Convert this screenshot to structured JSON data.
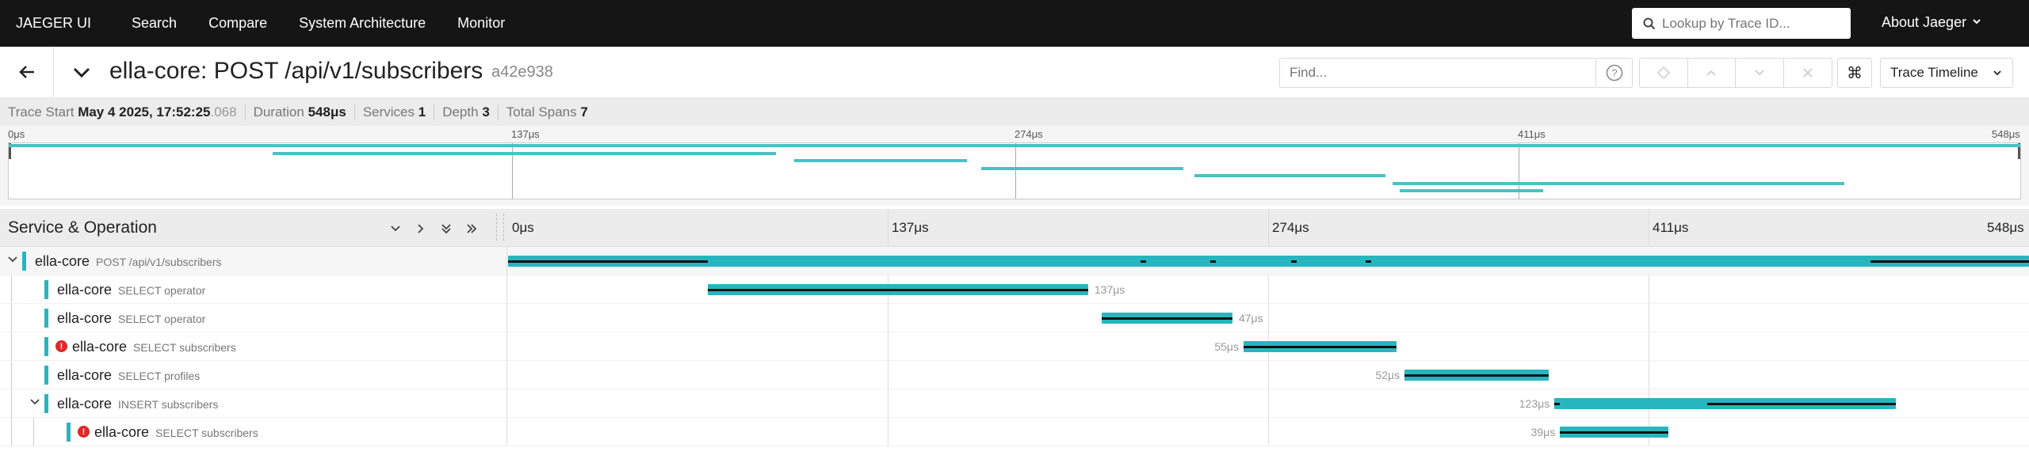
{
  "nav": {
    "brand": "JAEGER UI",
    "links": [
      "Search",
      "Compare",
      "System Architecture",
      "Monitor"
    ],
    "lookup_placeholder": "Lookup by Trace ID...",
    "about": "About Jaeger"
  },
  "trace": {
    "title": "ella-core: POST /api/v1/subscribers",
    "id": "a42e938",
    "find_placeholder": "Find...",
    "view_mode": "Trace Timeline"
  },
  "summary": {
    "trace_start_label": "Trace Start",
    "trace_start_value": "May 4 2025, 17:52:25",
    "trace_start_frac": ".068",
    "duration_label": "Duration",
    "duration_value": "548μs",
    "services_label": "Services",
    "services_value": "1",
    "depth_label": "Depth",
    "depth_value": "3",
    "total_spans_label": "Total Spans",
    "total_spans_value": "7"
  },
  "minimap_ticks": [
    "0μs",
    "137μs",
    "274μs",
    "411μs",
    "548μs"
  ],
  "timeline": {
    "header_label": "Service & Operation",
    "ticks": [
      "0μs",
      "137μs",
      "274μs",
      "411μs",
      "548μs"
    ]
  },
  "spans": [
    {
      "service": "ella-core",
      "operation": "POST /api/v1/subscribers",
      "start": 0,
      "duration": 548,
      "label": "",
      "error": false
    },
    {
      "service": "ella-core",
      "operation": "SELECT operator",
      "start": 72,
      "duration": 137,
      "label": "137μs",
      "error": false
    },
    {
      "service": "ella-core",
      "operation": "SELECT operator",
      "start": 214,
      "duration": 47,
      "label": "47μs",
      "error": false
    },
    {
      "service": "ella-core",
      "operation": "SELECT subscribers",
      "start": 265,
      "duration": 55,
      "label": "55μs",
      "error": true
    },
    {
      "service": "ella-core",
      "operation": "SELECT profiles",
      "start": 323,
      "duration": 52,
      "label": "52μs",
      "error": false
    },
    {
      "service": "ella-core",
      "operation": "INSERT subscribers",
      "start": 377,
      "duration": 123,
      "label": "123μs",
      "error": false
    },
    {
      "service": "ella-core",
      "operation": "SELECT subscribers",
      "start": 379,
      "duration": 39,
      "label": "39μs",
      "error": true
    }
  ]
}
